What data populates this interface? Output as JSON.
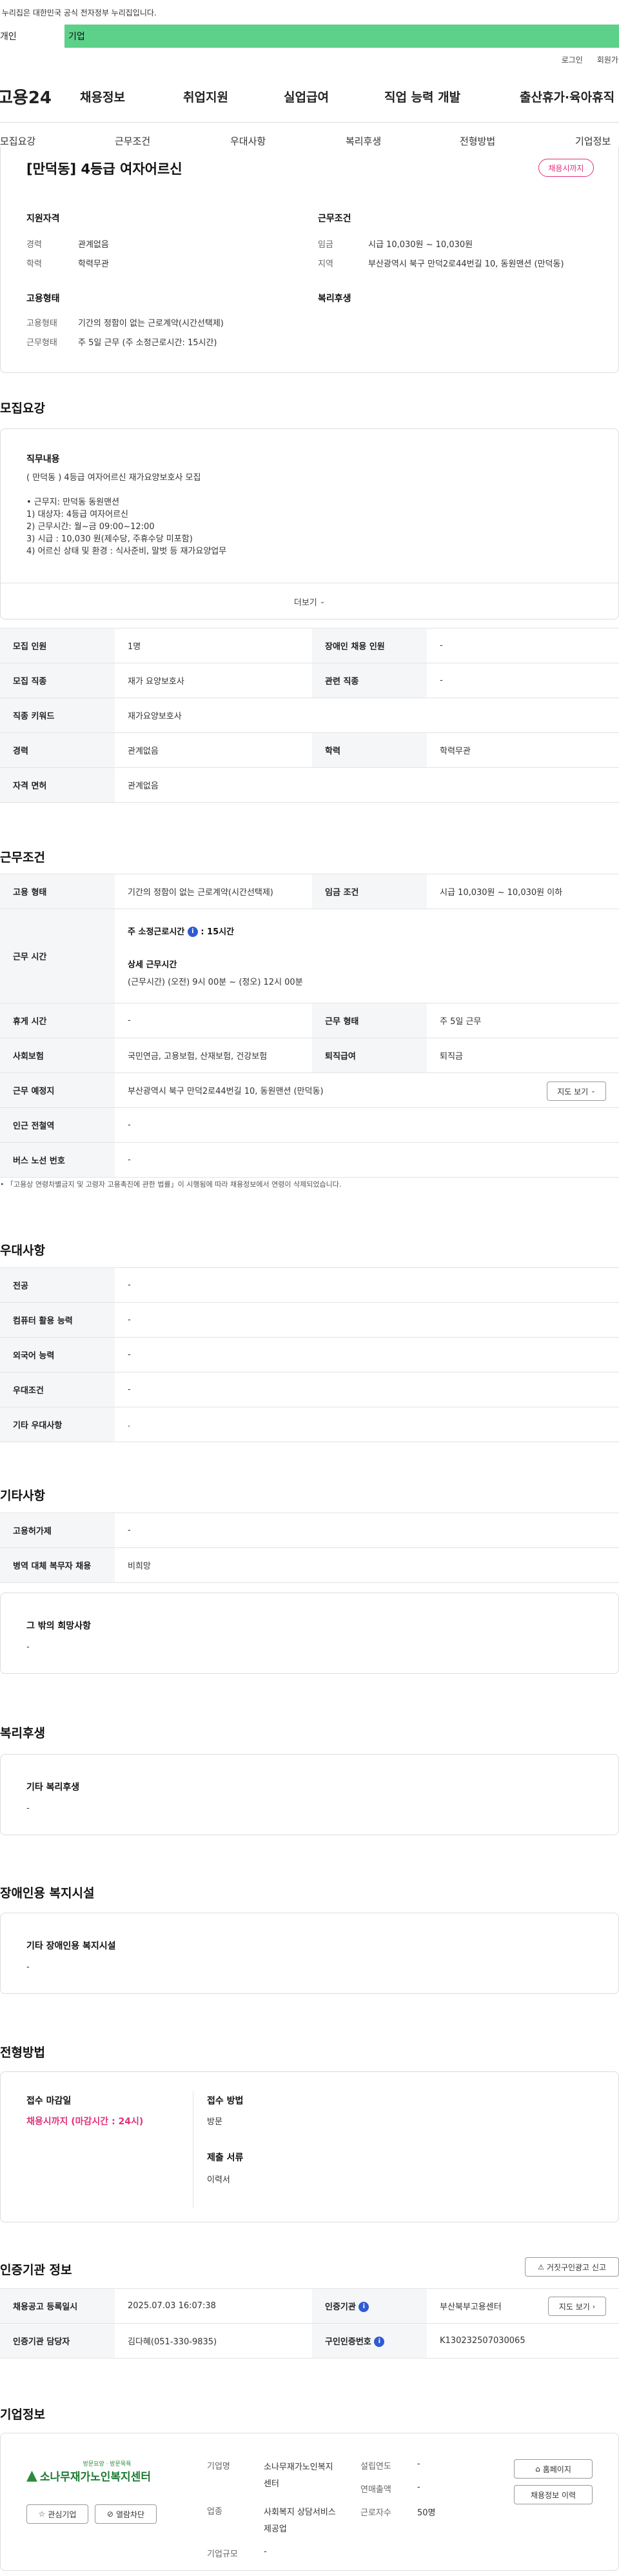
{
  "gov_banner": "이 누리집은 대한민국 공식 전자정부 누리집입니다.",
  "top_tabs": [
    "개인",
    "기업"
  ],
  "util_links": [
    "로그인",
    "회원가입"
  ],
  "logo": "고용24",
  "gnb_menu": [
    "채용정보",
    "취업지원",
    "실업급여",
    "직업 능력 개발",
    "출산휴가·육아휴직"
  ],
  "subnav": [
    "모집요강",
    "근무조건",
    "우대사항",
    "복리후생",
    "전형방법",
    "기업정보"
  ],
  "job_title": "[만덕동] 4등급 여자어르신",
  "status_badge": "채용시까지",
  "summary": {
    "qual_title": "지원자격",
    "career_label": "경력",
    "career_value": "관계없음",
    "edu_label": "학력",
    "edu_value": "학력무관",
    "cond_title": "근무조건",
    "wage_label": "임금",
    "wage_value": "시급 10,030원 ~ 10,030원",
    "region_label": "지역",
    "region_value": "부산광역시 북구 만덕2로44번길 10, 동원맨션 (만덕동)",
    "emp_title": "고용형태",
    "emp_type_label": "고용형태",
    "emp_type_value": "기간의 정함이 없는 근로계약(시간선택제)",
    "work_type_label": "근무형태",
    "work_type_value": "주 5일 근무 (주 소정근로시간: 15시간)",
    "welfare_title": "복리후생"
  },
  "recruit": {
    "section_title": "모집요강",
    "duty_title": "직무내용",
    "duty_lines": [
      "( 만덕동 ) 4등급 여자어르신 재가요양보호사 모집",
      "",
      "• 근무지: 만덕동 동원맨션",
      "1) 대상자: 4등급 여자어르신",
      "2) 근무시간: 월~금 09:00~12:00",
      "3) 시급 : 10,030 원(제수당, 주휴수당 미포함)",
      "4) 어르신 상태 및 환경 : 식사준비, 말벗 등 재가요양업무"
    ],
    "more_label": "더보기",
    "rows": [
      {
        "h1": "모집 인원",
        "v1": "1명",
        "h2": "장애인 채용 인원",
        "v2": "-"
      },
      {
        "h1": "모집 직종",
        "v1": "재가 요양보호사",
        "h2": "관련 직종",
        "v2": "-"
      },
      {
        "h1": "직종 키워드",
        "v1": "재가요양보호사"
      },
      {
        "h1": "경력",
        "v1": "관계없음",
        "h2": "학력",
        "v2": "학력무관"
      },
      {
        "h1": "자격 면허",
        "v1": "관계없음"
      }
    ]
  },
  "conditions": {
    "section_title": "근무조건",
    "emp_type_h": "고용 형태",
    "emp_type_v": "기간의 정함이 없는 근로계약(시간선택제)",
    "wage_h": "임금 조건",
    "wage_v": "시급 10,030원 ~ 10,030원 이하",
    "hours_h": "근무 시간",
    "weekly_hours_label": "주 소정근로시간",
    "weekly_hours_value": ": 15시간",
    "detail_hours_label": "상세 근무시간",
    "detail_hours_value": "(근무시간) (오전) 9시 00분 ~ (정오) 12시 00분",
    "break_h": "휴게 시간",
    "break_v": "-",
    "work_form_h": "근무 형태",
    "work_form_v": "주 5일 근무",
    "insurance_h": "사회보험",
    "insurance_v": "국민연금, 고용보험, 산재보험, 건강보험",
    "retire_h": "퇴직급여",
    "retire_v": "퇴직금",
    "location_h": "근무 예정지",
    "location_v": "부산광역시 북구 만덕2로44번길 10, 동원맨션 (만덕동)",
    "map_button": "지도 보기",
    "subway_h": "인근 전철역",
    "subway_v": "-",
    "bus_h": "버스 노선 번호",
    "bus_v": "-",
    "note": "「고용상 연령차별금지 및 고령자 고용촉진에 관한 법률」이 시행됨에 따라 채용정보에서 연령이 삭제되었습니다."
  },
  "preference": {
    "section_title": "우대사항",
    "rows": [
      {
        "h": "전공",
        "v": "-"
      },
      {
        "h": "컴퓨터 활용 능력",
        "v": "-"
      },
      {
        "h": "외국어 능력",
        "v": "-"
      },
      {
        "h": "우대조건",
        "v": "-"
      },
      {
        "h": "기타 우대사항",
        "v": "."
      }
    ]
  },
  "etc": {
    "section_title": "기타사항",
    "rows": [
      {
        "h": "고용허가제",
        "v": "-"
      },
      {
        "h": "병역 대체 복무자 채용",
        "v": "비희망"
      }
    ],
    "other_wish_title": "그 밖의 희망사항",
    "other_wish_value": "-"
  },
  "welfare": {
    "section_title": "복리후생",
    "box_title": "기타 복리후생",
    "box_value": "-"
  },
  "disability": {
    "section_title": "장애인용 복지시설",
    "box_title": "기타 장애인용 복지시설",
    "box_value": "-"
  },
  "selection": {
    "section_title": "전형방법",
    "deadline_title": "접수 마감일",
    "deadline_value": "채용시까지 (마감시간 : 24시)",
    "method_title": "접수 방법",
    "method_value": "방문",
    "docs_title": "제출 서류",
    "docs_value": "이력서"
  },
  "agency": {
    "section_title": "인증기관 정보",
    "report_button": "거짓구인광고 신고",
    "reg_date_h": "채용공고 등록일시",
    "reg_date_v": "2025.07.03 16:07:38",
    "agency_h": "인증기관",
    "agency_v": "부산북부고용센터",
    "map_button": "지도 보기",
    "manager_h": "인증기관 담당자",
    "manager_v": "김다혜(051-330-9835)",
    "auth_no_h": "구인인증번호",
    "auth_no_v": "K130232507030065"
  },
  "company": {
    "section_title": "기업정보",
    "logo_small_text": "방문요양 · 방문목욕",
    "logo_text": "소나무재가노인복지센터",
    "fav_button": "관심기업",
    "block_button": "열람차단",
    "name_label": "기업명",
    "name_value": "소나무재가노인복지센터",
    "industry_label": "업종",
    "industry_value": "사회복지 상담서비스 제공업",
    "size_label": "기업규모",
    "size_value": "-",
    "founded_label": "설립연도",
    "founded_value": "-",
    "revenue_label": "연매출액",
    "revenue_value": "-",
    "employees_label": "근로자수",
    "employees_value": "50명",
    "homepage_button": "홈페이지",
    "history_button": "채용정보 이력"
  },
  "colors": {
    "brand_green": "#5dd08a",
    "badge_pink": "#e0337a",
    "info_blue": "#2f5bd3"
  }
}
